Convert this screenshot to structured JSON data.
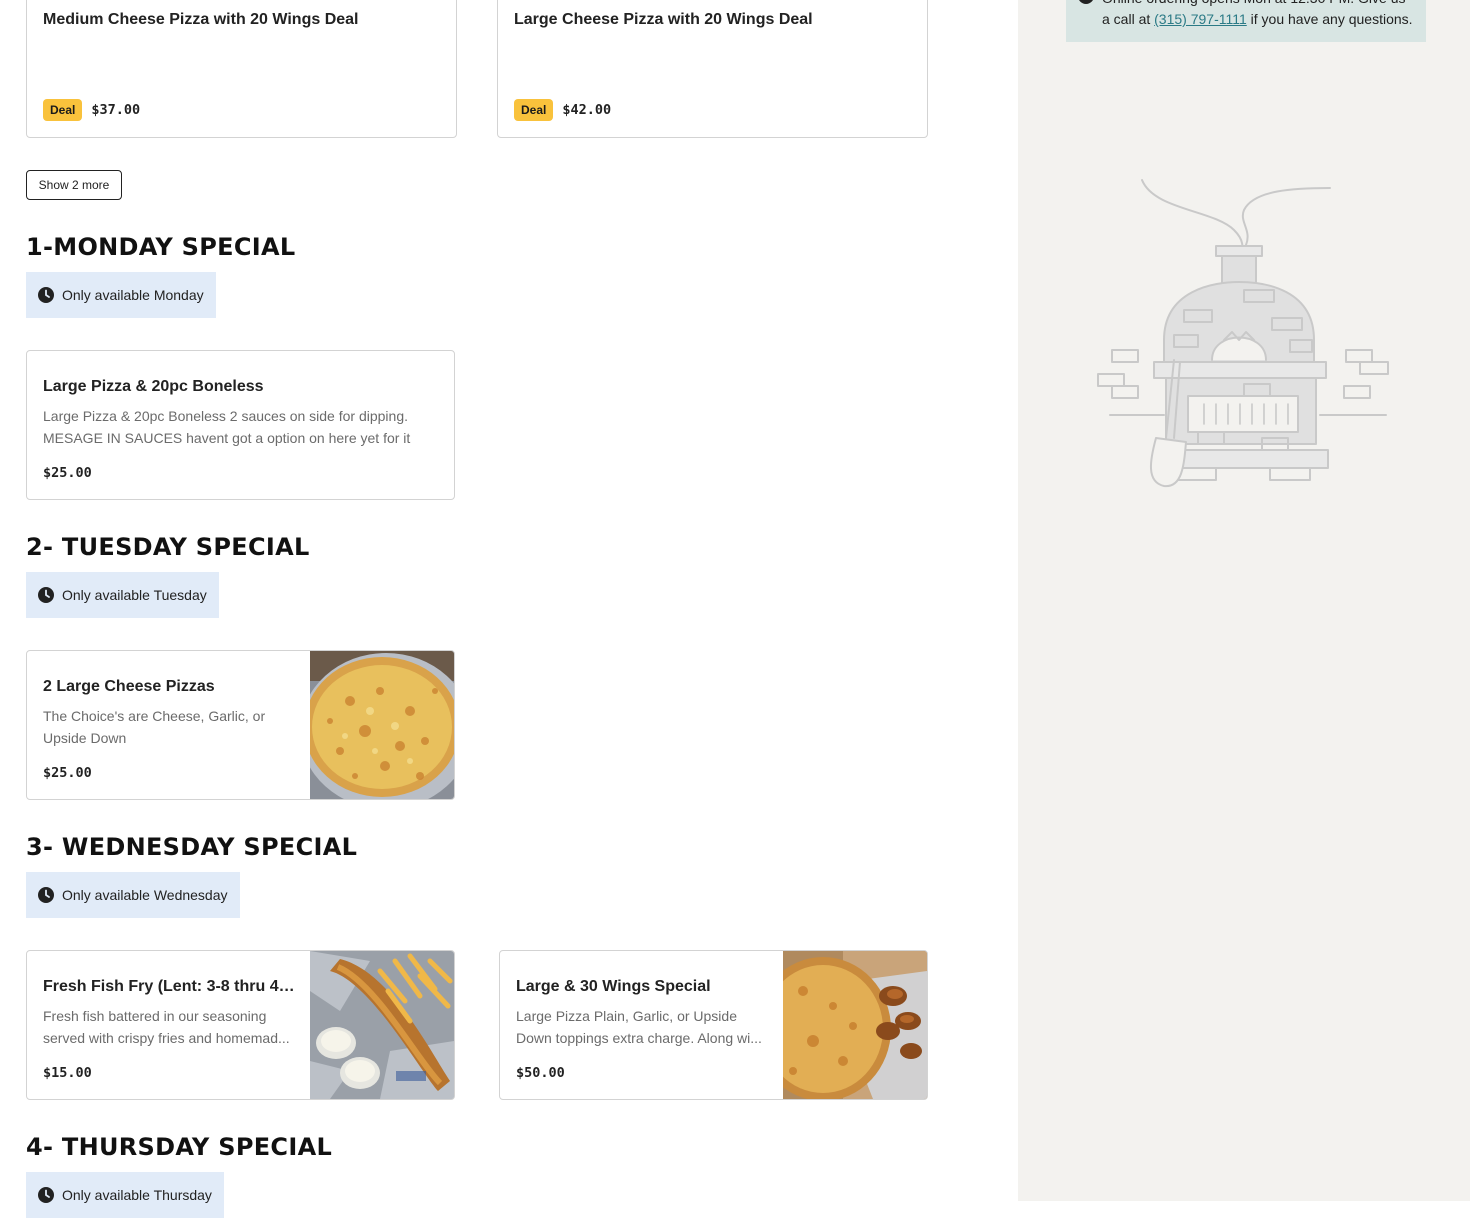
{
  "menu": {
    "top_deals": [
      {
        "name": "Medium Cheese Pizza with 20 Wings Deal",
        "badge": "Deal",
        "price": "$37.00"
      },
      {
        "name": "Large Cheese Pizza with 20 Wings Deal",
        "badge": "Deal",
        "price": "$42.00"
      }
    ],
    "show_more_label": "Show 2 more",
    "sections": [
      {
        "title": "1-MONDAY SPECIAL",
        "availability": "Only available Monday",
        "items": [
          {
            "name": "Large Pizza & 20pc Boneless",
            "description": "Large Pizza & 20pc Boneless 2 sauces on side for dipping. MESAGE IN SAUCES havent got a option on here yet for it",
            "price": "$25.00"
          }
        ]
      },
      {
        "title": "2- TUESDAY SPECIAL",
        "availability": "Only available Tuesday",
        "items": [
          {
            "name": "2 Large Cheese Pizzas",
            "description": "The Choice's are Cheese, Garlic, or Upside Down",
            "price": "$25.00"
          }
        ]
      },
      {
        "title": "3- WEDNESDAY SPECIAL",
        "availability": "Only available Wednesday",
        "items": [
          {
            "name": "Fresh Fish Fry (Lent: 3-8 thru 4-...",
            "description": "Fresh fish battered in our seasoning served with crispy fries and homemad...",
            "price": "$15.00"
          },
          {
            "name": "Large & 30 Wings Special",
            "description": "Large Pizza Plain, Garlic, or Upside Down toppings extra charge. Along wi...",
            "price": "$50.00"
          }
        ]
      },
      {
        "title": "4- THURSDAY SPECIAL",
        "availability": "Only available Thursday",
        "items": []
      }
    ]
  },
  "sidebar": {
    "notice_line1": "Online ordering opens Mon at 12:30 PM. Give us",
    "notice_prefix": "a call at ",
    "phone": "(315) 797-1111",
    "notice_suffix": " if you have any questions.",
    "illustration_icon": "pizza-oven-illustration"
  },
  "colors": {
    "deal_badge": "#f9c23c",
    "availability_bg": "#e1ebf8",
    "sidebar_bg": "#f3f2ef",
    "notice_bg": "#d8e5e3",
    "link": "#2b7a86"
  }
}
